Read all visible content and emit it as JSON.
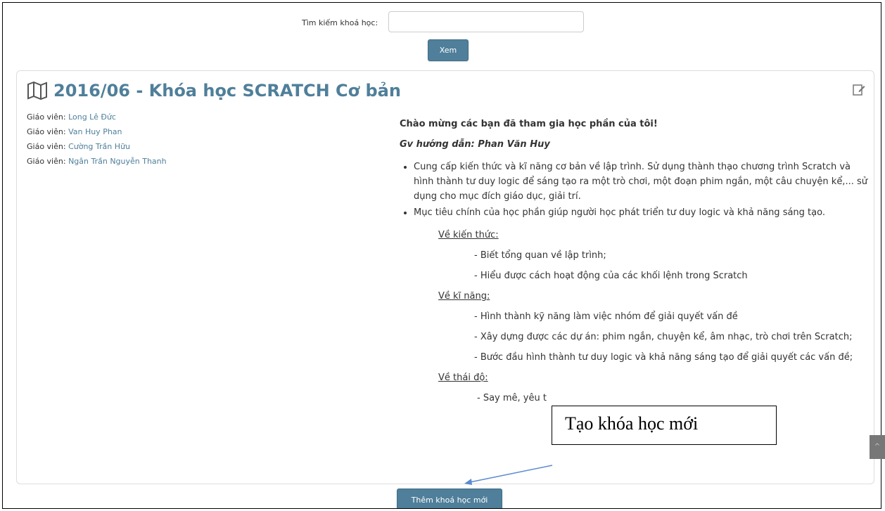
{
  "search": {
    "label": "Tìm kiếm khoá học:",
    "value": "",
    "button": "Xem"
  },
  "course": {
    "title": "2016/06 - Khóa học SCRATCH Cơ bản",
    "teachers": [
      {
        "role": "Giáo viên:",
        "name": "Long Lê Đức"
      },
      {
        "role": "Giáo viên:",
        "name": "Van Huy Phan"
      },
      {
        "role": "Giáo viên:",
        "name": "Cường Trần Hữu"
      },
      {
        "role": "Giáo viên:",
        "name": "Ngân Trần Nguyễn Thanh"
      }
    ],
    "summary": {
      "welcome": "Chào mừng các bạn đã tham gia học phần của tôi!",
      "guide": "Gv hướng dẫn: Phan Văn Huy",
      "bullets": [
        "Cung cấp kiến thức và kĩ năng cơ bản về lập trình. Sử dụng thành thạo chương trình Scratch và hình thành tư duy logic để sáng tạo ra một trò chơi, một đoạn phim ngắn, một câu chuyện kể,... sử dụng cho mục đích giáo dục, giải trí.",
        "Mục tiêu chính của học phần giúp người học phát triển tư duy logic và khả năng sáng tạo."
      ],
      "knowledge_head": "Về kiến thức:",
      "knowledge_items": [
        "- Biết tổng quan về lập trình;",
        "- Hiểu được cách hoạt động của các khối lệnh trong Scratch"
      ],
      "skills_head": "Về kĩ năng:",
      "skills_items": [
        "- Hình thành kỹ năng làm việc nhóm để giải quyết vấn đề",
        "- Xây dựng được các dự án: phim ngắn, chuyện kể, âm nhạc, trò chơi trên Scratch;",
        "- Bước đầu hình thành tư duy logic và khả năng sáng tạo để giải quyết các vấn đề;"
      ],
      "attitude_head": "Về thái độ:",
      "attitude_item": "- Say mê, yêu t"
    }
  },
  "add_button": "Thêm khoá học mới",
  "callout": "Tạo khóa học mới",
  "colors": {
    "accent": "#4f7f9a",
    "button": "#4f7f9a",
    "border": "#dddddd"
  },
  "icons": {
    "title": "map-icon",
    "edit": "edit-icon",
    "scroll": "scroll-top-icon"
  }
}
